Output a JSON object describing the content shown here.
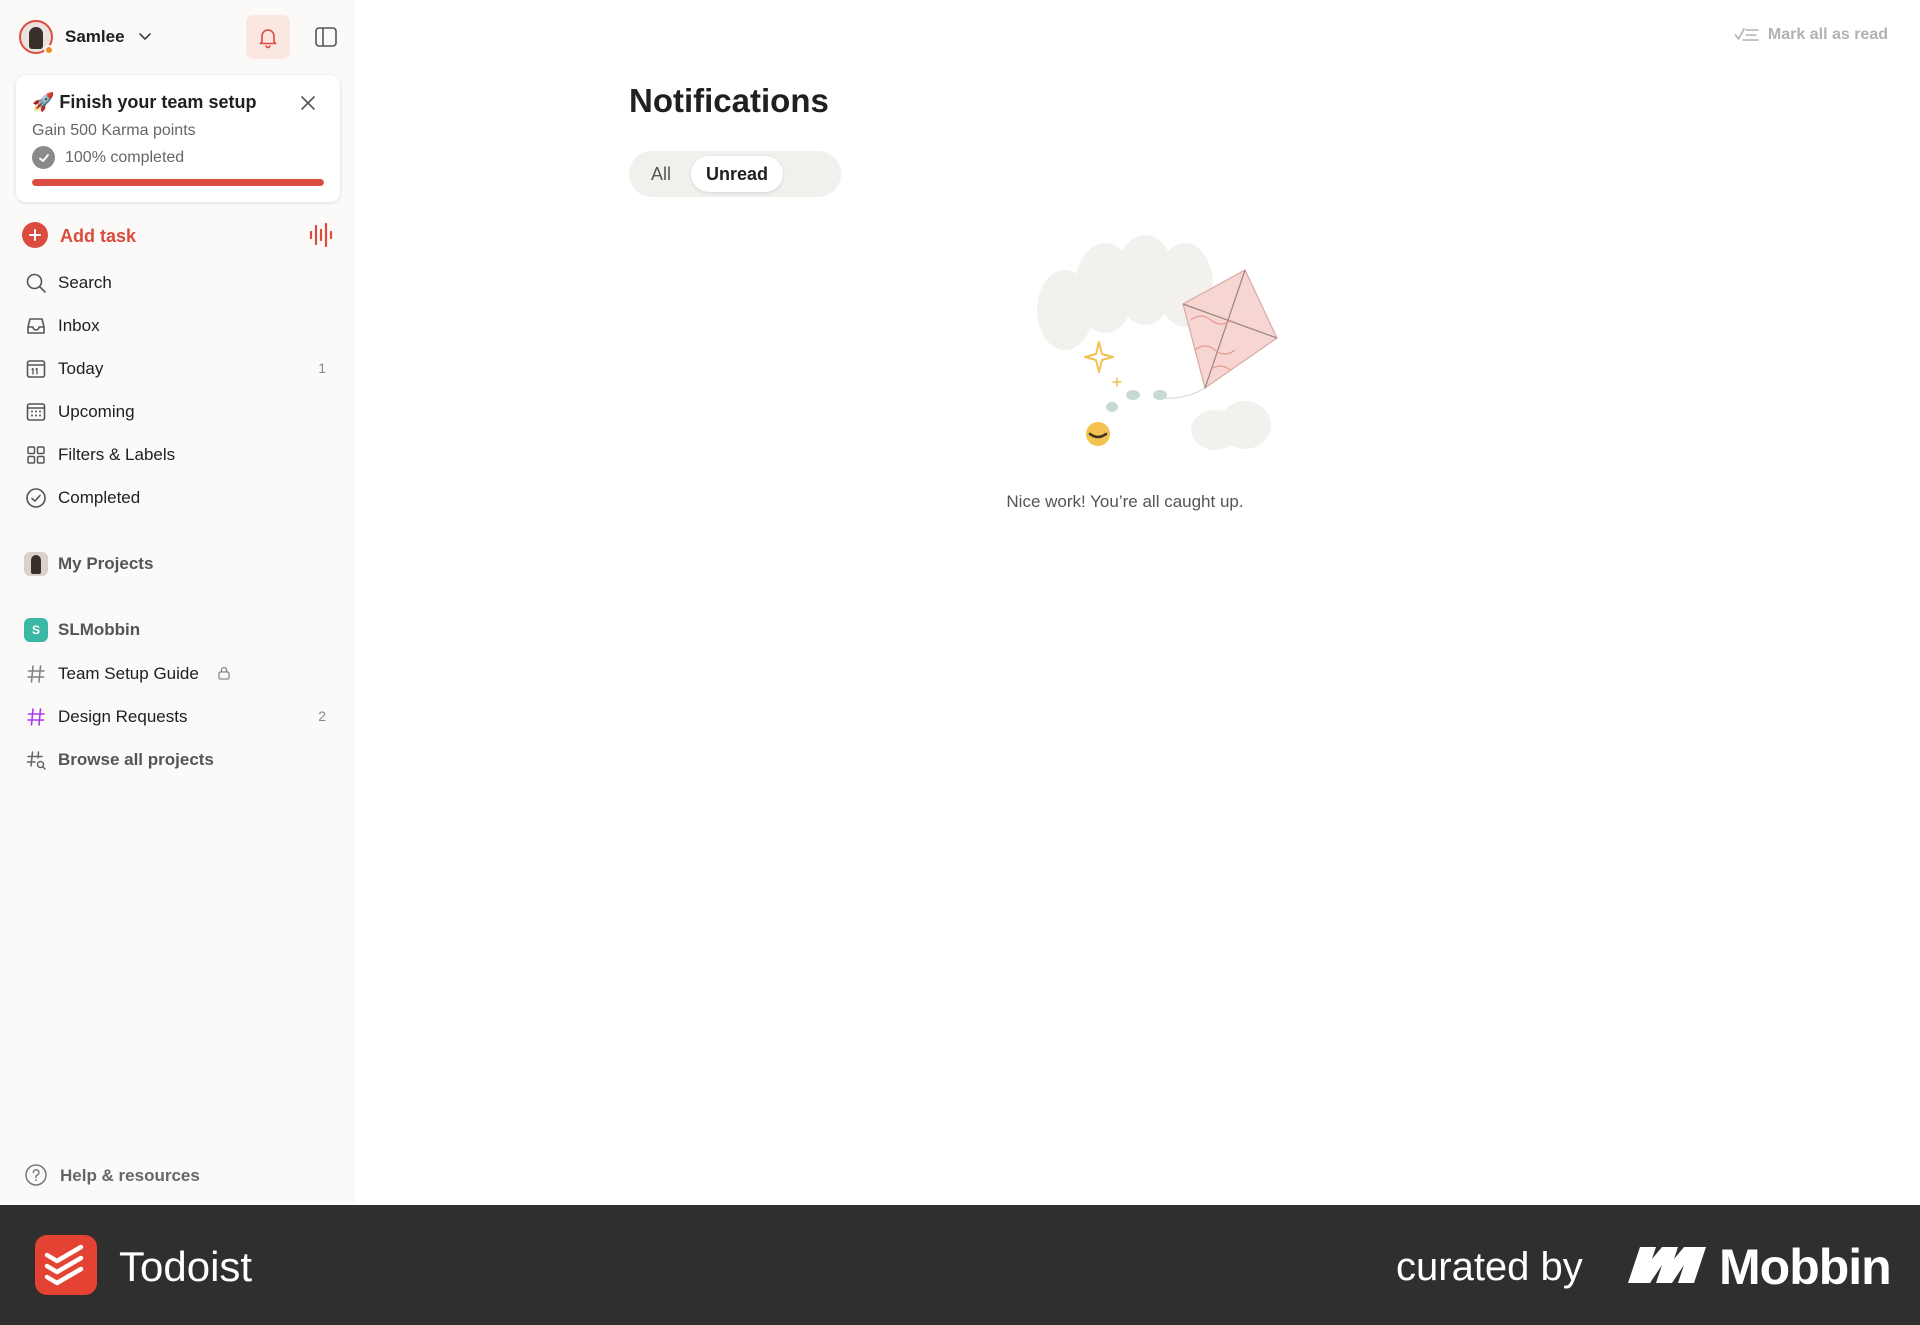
{
  "sidebar": {
    "user": {
      "name": "Samlee"
    },
    "setup_card": {
      "title": "🚀 Finish your team setup",
      "subtitle": "Gain 500 Karma points",
      "progress_label": "100% completed",
      "progress_fraction": 1.0
    },
    "add_task_label": "Add task",
    "nav_items": [
      {
        "label": "Search",
        "icon": "search-icon",
        "count": ""
      },
      {
        "label": "Inbox",
        "icon": "inbox-icon",
        "count": ""
      },
      {
        "label": "Today",
        "icon": "calendar-today-icon",
        "count": "1"
      },
      {
        "label": "Upcoming",
        "icon": "calendar-grid-icon",
        "count": ""
      },
      {
        "label": "Filters & Labels",
        "icon": "filters-icon",
        "count": ""
      },
      {
        "label": "Completed",
        "icon": "check-circle-icon",
        "count": ""
      }
    ],
    "my_projects_label": "My Projects",
    "team": {
      "badge": "S",
      "name": "SLMobbin",
      "projects": [
        {
          "label": "Team Setup Guide",
          "count": "",
          "locked": true,
          "color": "#808080"
        },
        {
          "label": "Design Requests",
          "count": "2",
          "locked": false,
          "color": "#af38eb"
        }
      ],
      "browse_label": "Browse all projects"
    },
    "help_label": "Help & resources"
  },
  "main": {
    "mark_all_read": "Mark all as read",
    "title": "Notifications",
    "tabs": [
      "All",
      "Unread"
    ],
    "selected_tab": "Unread",
    "empty_message": "Nice work! You’re all caught up."
  },
  "footer": {
    "app_name": "Todoist",
    "curated_by": "curated by",
    "brand": "Mobbin"
  },
  "colors": {
    "accent": "#dc4c3e",
    "sidebar_bg": "#fcfaf8",
    "footer_bg": "#2f2f2f"
  }
}
